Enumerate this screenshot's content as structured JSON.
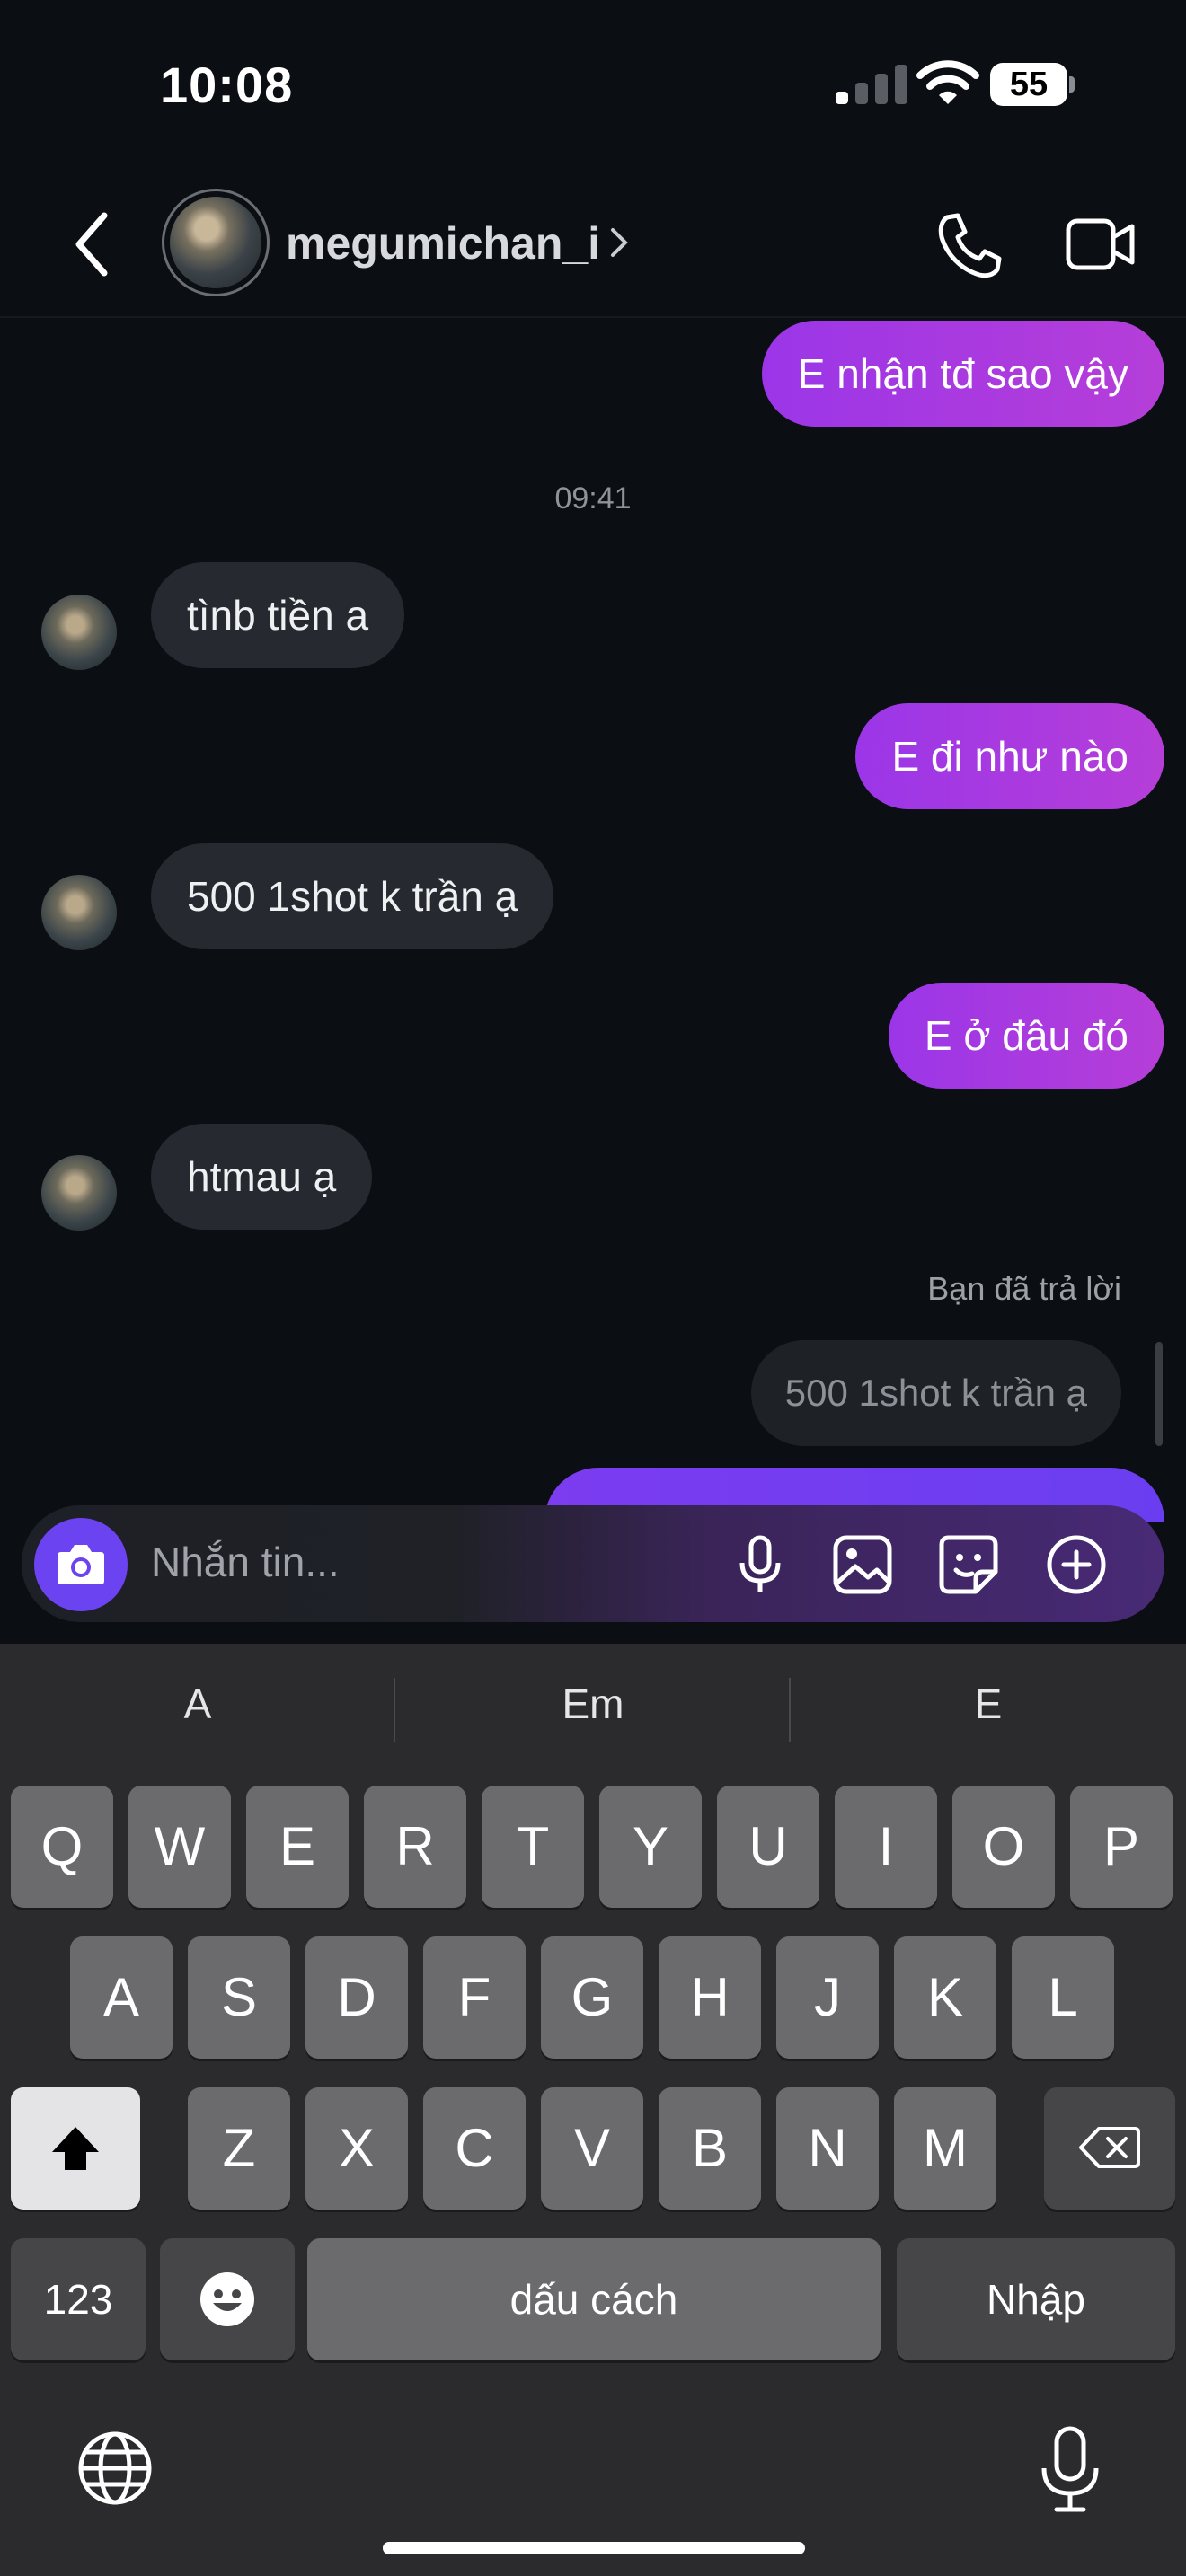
{
  "status_bar": {
    "time": "10:08",
    "battery": "55"
  },
  "header": {
    "username": "megumichan_i"
  },
  "messages": {
    "m1": "E nhận tđ sao vậy",
    "timestamp": "09:41",
    "m2": "tìnb tiền a",
    "m3": "E đi như nào",
    "m4": "500 1shot k trần ạ",
    "m5": "E ở đâu đó",
    "m6": "htmau ạ",
    "reply_label": "Bạn đã trả lời",
    "reply_quote": "500 1shot k trần ạ"
  },
  "composer": {
    "placeholder": "Nhắn tin..."
  },
  "keyboard": {
    "suggestions": [
      "A",
      "Em",
      "E"
    ],
    "row1": [
      "Q",
      "W",
      "E",
      "R",
      "T",
      "Y",
      "U",
      "I",
      "O",
      "P"
    ],
    "row2": [
      "A",
      "S",
      "D",
      "F",
      "G",
      "H",
      "J",
      "K",
      "L"
    ],
    "row3": [
      "Z",
      "X",
      "C",
      "V",
      "B",
      "N",
      "M"
    ],
    "numbers": "123",
    "space": "dấu cách",
    "return": "Nhập"
  },
  "colors": {
    "outgoing": "#9b36e8",
    "incoming": "#262a30",
    "accent": "#6c43f0"
  }
}
